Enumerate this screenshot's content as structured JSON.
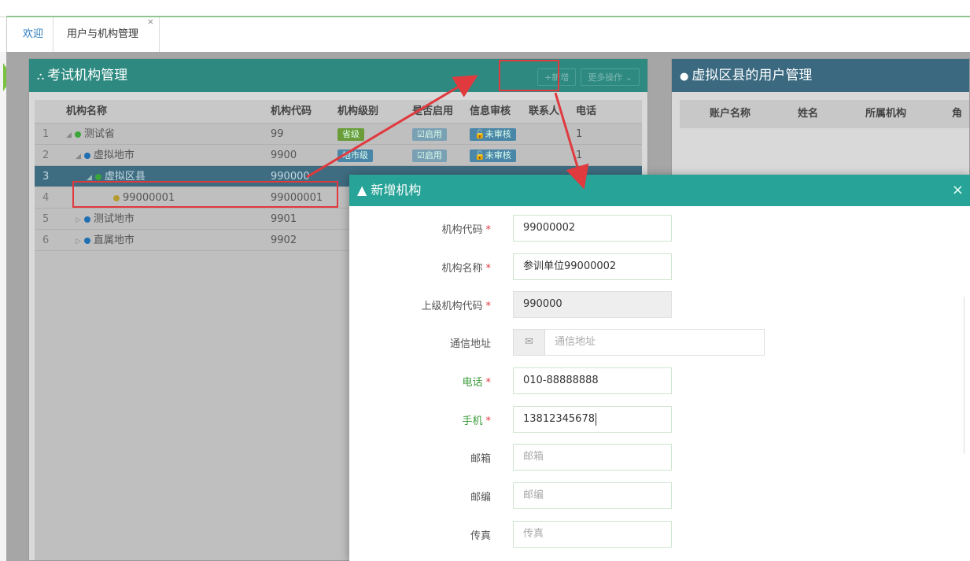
{
  "tabs": [
    {
      "label": "欢迎"
    },
    {
      "label": "用户与机构管理",
      "close": "×"
    }
  ],
  "left_panel": {
    "title": "考试机构管理",
    "new_btn": "+新增",
    "more_btn": "更多操作 ⌄",
    "columns": [
      "机构名称",
      "机构代码",
      "机构级别",
      "是否启用",
      "信息审核",
      "联系人",
      "电话"
    ],
    "rows": [
      {
        "num": "1",
        "tri": "◢",
        "icon": "green",
        "name": "测试省",
        "code": "99",
        "level": "省级",
        "enable": "☑启用",
        "audit": "🔓未审核",
        "contact": "",
        "phone": "1"
      },
      {
        "num": "2",
        "tri": "◢",
        "icon": "blue",
        "name": "虚拟地市",
        "code": "9900",
        "level": "地市级",
        "enable": "☑启用",
        "audit": "🔓未审核",
        "contact": "",
        "phone": "1"
      },
      {
        "num": "3",
        "tri": "◢",
        "icon": "green",
        "name": "虚拟区县",
        "code": "990000",
        "level": "",
        "enable": "",
        "audit": "",
        "contact": "",
        "phone": ""
      },
      {
        "num": "4",
        "tri": "",
        "icon": "yellow",
        "name": "99000001",
        "code": "99000001",
        "level": "",
        "enable": "",
        "audit": "",
        "contact": "",
        "phone": ""
      },
      {
        "num": "5",
        "tri": "▷",
        "icon": "blue",
        "name": "测试地市",
        "code": "9901",
        "level": "",
        "enable": "",
        "audit": "",
        "contact": "",
        "phone": ""
      },
      {
        "num": "6",
        "tri": "▷",
        "icon": "blue",
        "name": "直属地市",
        "code": "9902",
        "level": "",
        "enable": "",
        "audit": "",
        "contact": "",
        "phone": ""
      }
    ]
  },
  "right_panel": {
    "title": "虚拟区县的用户管理",
    "columns": [
      "账户名称",
      "姓名",
      "所属机构",
      "角"
    ]
  },
  "modal": {
    "title": "新增机构",
    "close": "×",
    "fields": {
      "org_code": {
        "label": "机构代码",
        "value": "99000002"
      },
      "org_name": {
        "label": "机构名称",
        "value": "参训单位99000002"
      },
      "parent_code": {
        "label": "上级机构代码",
        "value": "990000"
      },
      "address": {
        "label": "通信地址",
        "placeholder": "通信地址"
      },
      "phone": {
        "label": "电话",
        "value": "010-88888888"
      },
      "mobile": {
        "label": "手机",
        "value": "13812345678"
      },
      "email": {
        "label": "邮箱",
        "placeholder": "邮箱"
      },
      "postcode": {
        "label": "邮编",
        "placeholder": "邮编"
      },
      "fax": {
        "label": "传真",
        "placeholder": "传真"
      }
    },
    "required_mark": "*"
  },
  "icons": {
    "panel_icon": "sitemap-icon",
    "user_icon": "user-icon",
    "envelope": "envelope-icon"
  },
  "colors": {
    "accent_teal": "#27a397",
    "highlight_red": "#e0393e"
  }
}
